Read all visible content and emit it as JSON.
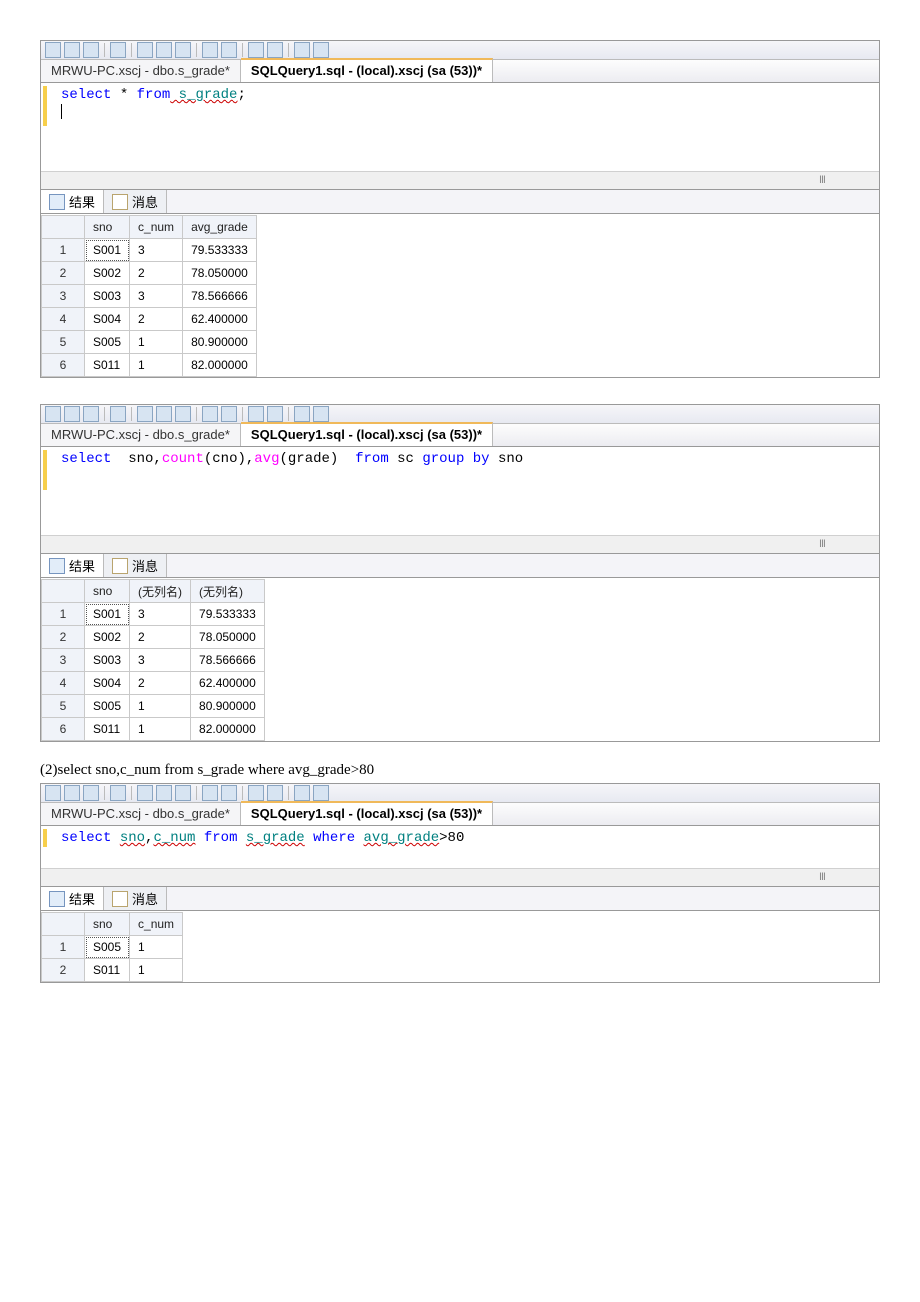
{
  "tabs": {
    "inactive": "MRWU-PC.xscj - dbo.s_grade*",
    "active": "SQLQuery1.sql - (local).xscj (sa (53))*"
  },
  "resultsTabs": {
    "results": "结果",
    "messages": "消息"
  },
  "panel1": {
    "sql_kw_select": "select",
    "sql_star": " * ",
    "sql_kw_from": "from",
    "sql_table": " s_grade",
    "sql_semi": ";",
    "headers": [
      "sno",
      "c_num",
      "avg_grade"
    ],
    "rows": [
      [
        "S001",
        "3",
        "79.533333"
      ],
      [
        "S002",
        "2",
        "78.050000"
      ],
      [
        "S003",
        "3",
        "78.566666"
      ],
      [
        "S004",
        "2",
        "62.400000"
      ],
      [
        "S005",
        "1",
        "80.900000"
      ],
      [
        "S011",
        "1",
        "82.000000"
      ]
    ]
  },
  "panel2": {
    "sql_kw_select": "select",
    "sql_cols1": "  sno,",
    "sql_fn_count": "count",
    "sql_arg_count": "(cno),",
    "sql_fn_avg": "avg",
    "sql_arg_avg": "(grade)  ",
    "sql_kw_from": "from",
    "sql_rest": " sc ",
    "sql_kw_group": "group",
    "sql_kw_by": " by",
    "sql_col_sno": " sno",
    "headers": [
      "sno",
      "(无列名)",
      "(无列名)"
    ],
    "rows": [
      [
        "S001",
        "3",
        "79.533333"
      ],
      [
        "S002",
        "2",
        "78.050000"
      ],
      [
        "S003",
        "3",
        "78.566666"
      ],
      [
        "S004",
        "2",
        "62.400000"
      ],
      [
        "S005",
        "1",
        "80.900000"
      ],
      [
        "S011",
        "1",
        "82.000000"
      ]
    ]
  },
  "caption2": "(2)select sno,c_num from s_grade where avg_grade>80",
  "panel3": {
    "sql_kw_select": "select",
    "sql_sp1": " ",
    "sql_col_sno": "sno",
    "sql_comma": ",",
    "sql_col_cnum": "c_num",
    "sql_sp2": " ",
    "sql_kw_from": "from",
    "sql_sp3": " ",
    "sql_table": "s_grade",
    "sql_sp4": " ",
    "sql_kw_where": "where",
    "sql_sp5": " ",
    "sql_col_avg": "avg_grade",
    "sql_gt": ">80",
    "headers": [
      "sno",
      "c_num"
    ],
    "rows": [
      [
        "S005",
        "1"
      ],
      [
        "S011",
        "1"
      ]
    ]
  }
}
